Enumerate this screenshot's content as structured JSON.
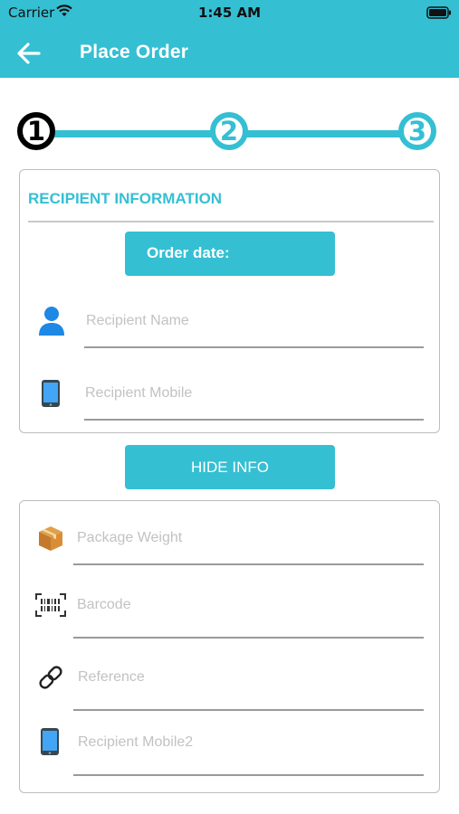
{
  "status_bar": {
    "carrier": "Carrier",
    "time": "1:45 AM"
  },
  "header": {
    "title": "Place Order",
    "back_icon": "arrow-left-icon"
  },
  "stepper": {
    "steps": [
      "1",
      "2",
      "3"
    ],
    "active_step": 1,
    "accent": "#35BFD3"
  },
  "recipient_section": {
    "title": "RECIPIENT INFORMATION",
    "order_date_label": "Order date:",
    "name_placeholder": "Recipient Name",
    "mobile_placeholder": "Recipient Mobile"
  },
  "hide_info_button": "HIDE INFO",
  "package_section": {
    "weight_placeholder": "Package Weight",
    "barcode_placeholder": "Barcode",
    "reference_placeholder": "Reference",
    "mobile2_placeholder": "Recipient Mobile2"
  },
  "icons": {
    "person": "person-icon",
    "phone": "phone-icon",
    "package": "package-box-icon",
    "barcode": "barcode-icon",
    "link": "link-icon"
  },
  "colors": {
    "primary": "#35BFD3",
    "person_icon": "#1E88E5"
  }
}
